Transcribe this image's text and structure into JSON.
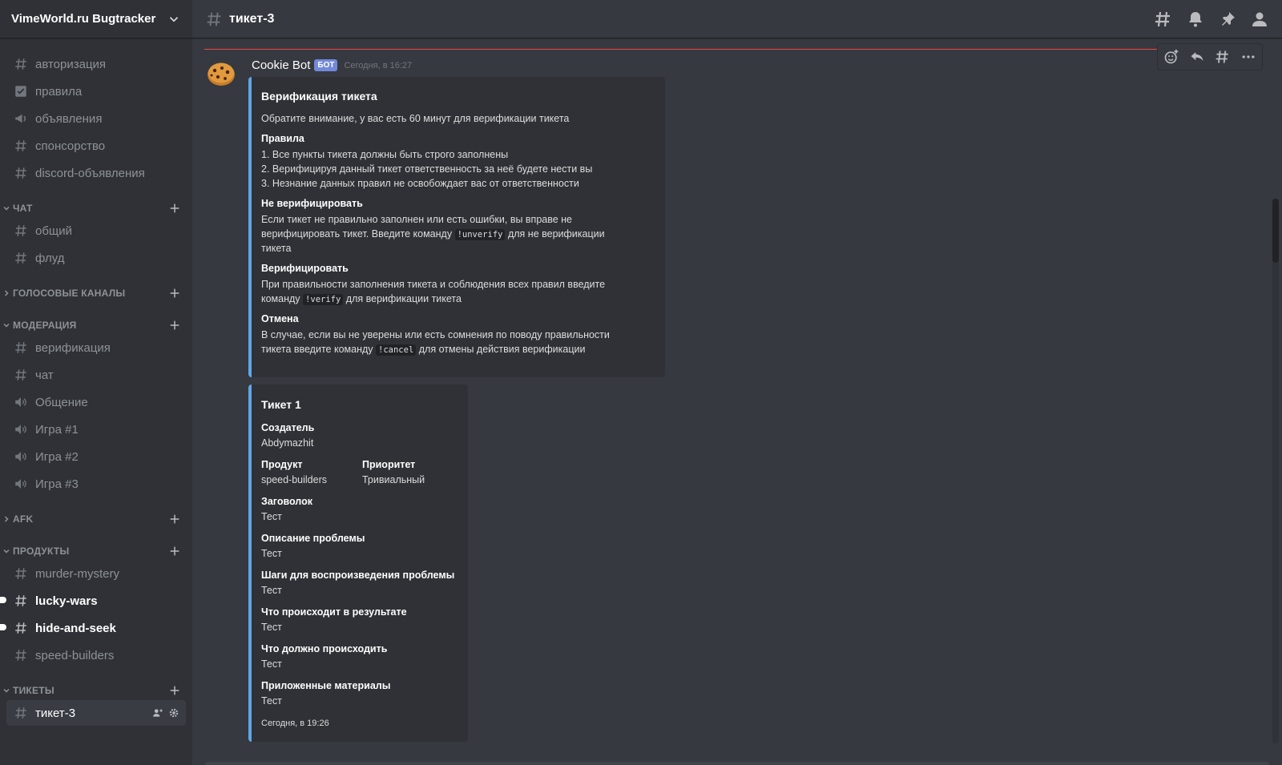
{
  "guild": {
    "name": "VimeWorld.ru Bugtracker"
  },
  "sidebar": {
    "top_channels": [
      {
        "label": "авторизация",
        "icon": "hash-icon"
      },
      {
        "label": "правила",
        "icon": "checkbox-icon"
      },
      {
        "label": "объявления",
        "icon": "megaphone-icon"
      },
      {
        "label": "спонсорство",
        "icon": "hash-icon"
      },
      {
        "label": "discord-объявления",
        "icon": "hash-icon"
      }
    ],
    "chat_category": "ЧАТ",
    "chat_channels": [
      "общий",
      "флуд"
    ],
    "voice_category": "ГОЛОСОВЫЕ КАНАЛЫ",
    "moderation_category": "МОДЕРАЦИЯ",
    "moderation_channels": [
      {
        "label": "верификация",
        "icon": "hash-icon"
      },
      {
        "label": "чат",
        "icon": "hash-icon"
      },
      {
        "label": "Общение",
        "icon": "speaker-icon"
      },
      {
        "label": "Игра #1",
        "icon": "speaker-icon"
      },
      {
        "label": "Игра #2",
        "icon": "speaker-icon"
      },
      {
        "label": "Игра #3",
        "icon": "speaker-icon"
      }
    ],
    "afk_category": "AFK",
    "products_category": "ПРОДУКТЫ",
    "product_channels": [
      {
        "label": "murder-mystery",
        "unread": false
      },
      {
        "label": "lucky-wars",
        "unread": true
      },
      {
        "label": "hide-and-seek",
        "unread": true
      },
      {
        "label": "speed-builders",
        "unread": false
      }
    ],
    "tickets_category": "ТИКЕТЫ",
    "ticket_channel": "тикет-3"
  },
  "header": {
    "channel": "тикет-3"
  },
  "message": {
    "author": "Cookie Bot",
    "bot_tag": "БОТ",
    "timestamp": "Сегодня, в 16:27",
    "embed1": {
      "title": "Верификация тикета",
      "description": "Обратите внимание, у вас есть 60 минут для верификации тикета",
      "rules_title": "Правила",
      "rules": [
        "1. Все пункты тикета должны быть строго заполнены",
        "2. Верифицируя данный тикет ответственность за неё будете нести вы",
        "3. Незнание данных правил не освобождает вас от ответственности"
      ],
      "noverify_title": "Не верифицировать",
      "noverify_l1": "Если тикет не правильно заполнен или есть ошибки, вы вправе не",
      "noverify_l2a": "верифицировать тикет. Введите команду",
      "noverify_cmd": "!unverify",
      "noverify_l2b": "для не верификации",
      "noverify_l3": "тикета",
      "verify_title": "Верифицировать",
      "verify_l1": "При правильности заполнения тикета и соблюдения всех правил введите",
      "verify_l2a": "команду",
      "verify_cmd": "!verify",
      "verify_l2b": "для верификации тикета",
      "cancel_title": "Отмена",
      "cancel_l1": "В случае, если вы не уверены или есть сомнения по поводу правильности",
      "cancel_l2a": "тикета введите команду",
      "cancel_cmd": "!cancel",
      "cancel_l2b": "для отмены действия верификации"
    },
    "embed2": {
      "title": "Тикет 1",
      "fields": {
        "creator_name": "Создатель",
        "creator_value": "Abdymazhit",
        "product_name": "Продукт",
        "product_value": "speed-builders",
        "priority_name": "Приоритет",
        "priority_value": "Тривиальный",
        "subject_name": "Заговолок",
        "subject_value": "Тест",
        "problem_name": "Описание проблемы",
        "problem_value": "Тест",
        "steps_name": "Шаги для воспроизведения проблемы",
        "steps_value": "Тест",
        "result_name": "Что происходит в результате",
        "result_value": "Тест",
        "expected_name": "Что должно происходить",
        "expected_value": "Тест",
        "attachments_name": "Приложенные материалы",
        "attachments_value": "Тест"
      },
      "footer": "Сегодня, в 19:26"
    }
  },
  "colors": {
    "embed_accent": "#5fa7e6",
    "bot_tag": "#7289da",
    "new_messages_line": "#f04747"
  }
}
